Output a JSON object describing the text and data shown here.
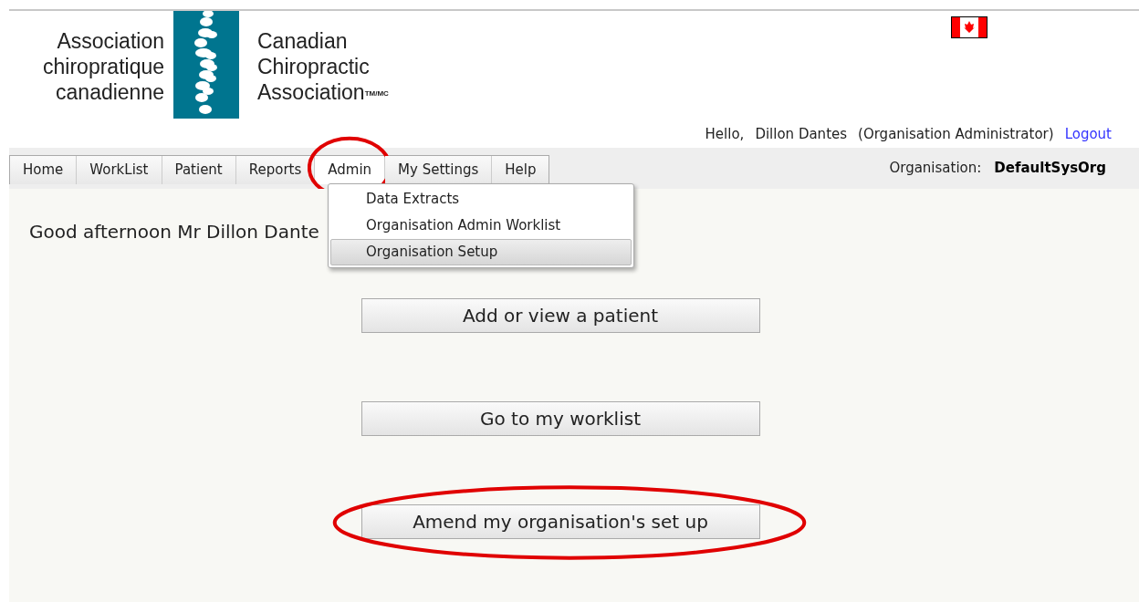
{
  "logo": {
    "french_lines": [
      "Association",
      "chiropratique",
      "canadienne"
    ],
    "english_lines": [
      "Canadian",
      "Chiropractic",
      "Association$^{TM/MC}$"
    ]
  },
  "user_bar": {
    "greeting": "Hello,",
    "user": "Dillon Dantes",
    "role": "(Organisation Administrator)",
    "logout": "Logout"
  },
  "nav": {
    "tabs": [
      {
        "label": "Home",
        "selected": false
      },
      {
        "label": "WorkList",
        "selected": false
      },
      {
        "label": "Patient",
        "selected": false
      },
      {
        "label": "Reports",
        "selected": false
      },
      {
        "label": "Admin",
        "selected": true
      },
      {
        "label": "My Settings",
        "selected": false
      },
      {
        "label": "Help",
        "selected": false
      }
    ],
    "organisation_label": "Organisation:",
    "organisation": "DefaultSysOrg"
  },
  "admin_menu": [
    {
      "label": "Data Extracts",
      "selected": false
    },
    {
      "label": "Organisation Admin Worklist",
      "selected": false
    },
    {
      "label": "Organisation Setup",
      "selected": true
    }
  ],
  "welcome": "Good afternoon Mr Dillon Dante",
  "actions": [
    {
      "label": "Add or view a patient",
      "highlighted": false
    },
    {
      "label": "Go to my worklist",
      "highlighted": false
    },
    {
      "label": "Amend my organisation's set up",
      "highlighted": true
    }
  ]
}
